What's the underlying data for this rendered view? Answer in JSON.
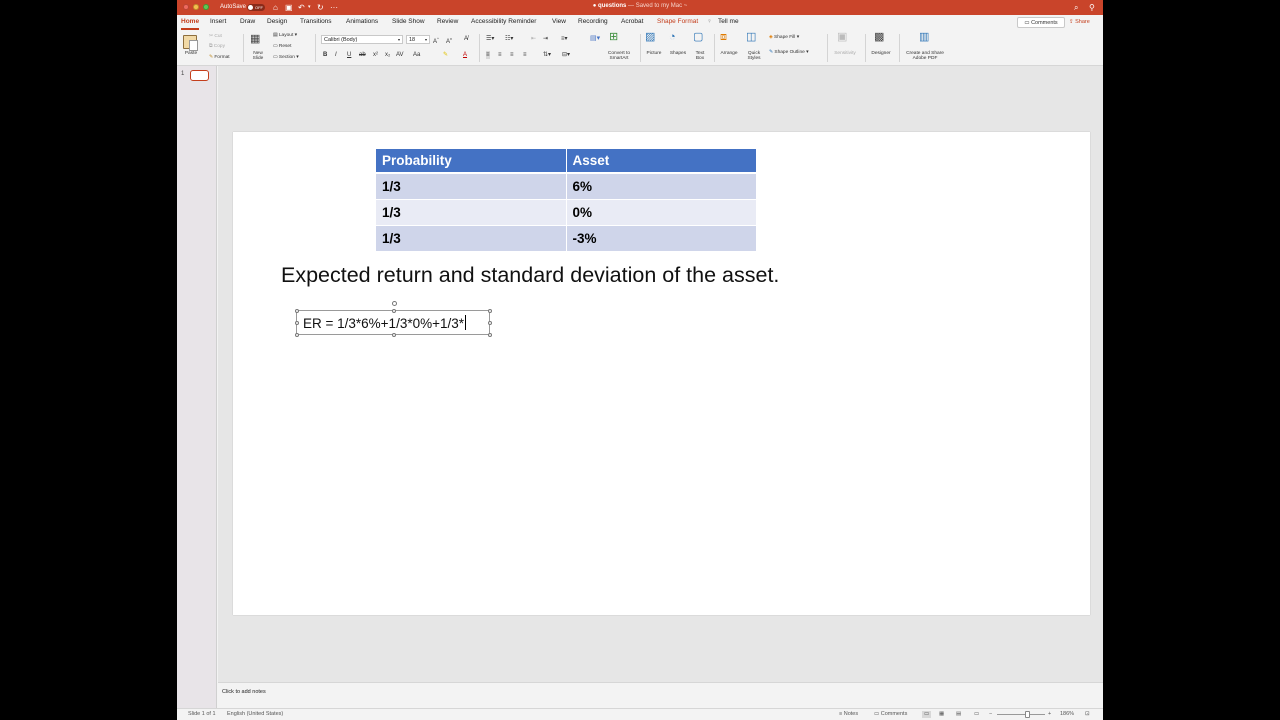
{
  "titlebar": {
    "autosave_label": "AutoSave",
    "autosave_state": "OFF",
    "doc_name": "questions",
    "doc_status": "— Saved to my Mac ~"
  },
  "tabs": [
    "Home",
    "Insert",
    "Draw",
    "Design",
    "Transitions",
    "Animations",
    "Slide Show",
    "Review",
    "Accessibility Reminder",
    "View",
    "Recording",
    "Acrobat",
    "Shape Format",
    "Tell me"
  ],
  "header_buttons": {
    "comments": "Comments",
    "share": "Share"
  },
  "ribbon": {
    "paste": "Paste",
    "cut": "Cut",
    "copy": "Copy",
    "format": "Format",
    "new_slide": "New\nSlide",
    "layout": "Layout",
    "reset": "Reset",
    "section": "Section",
    "font_name": "Calibri (Body)",
    "font_size": "18",
    "convert_smartart": "Convert to\nSmartArt",
    "picture": "Picture",
    "shapes": "Shapes",
    "text_box": "Text\nBox",
    "arrange": "Arrange",
    "quick_styles": "Quick\nStyles",
    "shape_fill": "Shape Fill",
    "shape_outline": "Shape Outline",
    "sensitivity": "Sensitivity",
    "designer": "Designer",
    "create_share_pdf": "Create and Share\nAdobe PDF"
  },
  "thumbnail": {
    "number": "1"
  },
  "slide": {
    "table": {
      "headers": [
        "Probability",
        "Asset"
      ],
      "rows": [
        [
          "1/3",
          "6%"
        ],
        [
          "1/3",
          "0%"
        ],
        [
          "1/3",
          "-3%"
        ]
      ]
    },
    "heading": "Expected return and standard deviation of the asset.",
    "textbox": "ER = 1/3*6%+1/3*0%+1/3*"
  },
  "notes_placeholder": "Click to add notes",
  "status": {
    "slide_count": "Slide 1 of 1",
    "language": "English (United States)",
    "notes": "Notes",
    "comments": "Comments",
    "zoom": "186%"
  },
  "colors": {
    "titlebar": "#c9442a",
    "accent": "#c43e1c",
    "table_header": "#4472c4",
    "table_row_odd": "#cfd5ea",
    "table_row_even": "#e9ebf5"
  }
}
